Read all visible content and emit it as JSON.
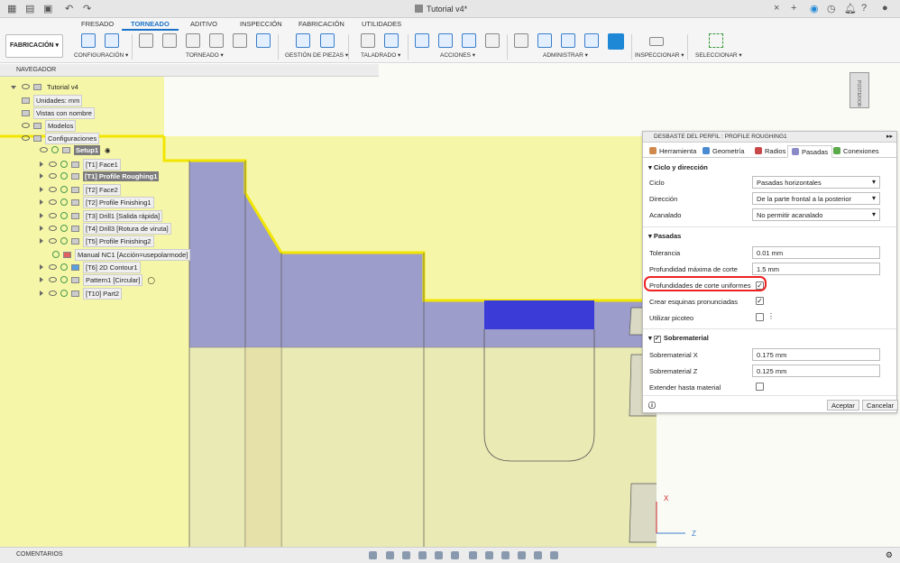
{
  "titlebar": {
    "doc_title": "Tutorial v4*"
  },
  "ribbon": {
    "tabs": [
      "FRESADO",
      "TORNEADO",
      "ADITIVO",
      "INSPECCIÓN",
      "FABRICACIÓN",
      "UTILIDADES"
    ],
    "active_tab": "TORNEADO",
    "workspace_button": "FABRICACIÓN ▾",
    "groups": [
      "CONFIGURACIÓN ▾",
      "TORNEADO ▾",
      "GESTIÓN DE PIEZAS ▾",
      "TALADRADO ▾",
      "ACCIONES ▾",
      "ADMINISTRAR ▾",
      "INSPECCIONAR ▾",
      "SELECCIONAR ▾"
    ]
  },
  "browser": {
    "title": "NAVEGADOR",
    "items": [
      {
        "label": "Tutorial v4"
      },
      {
        "label": "Unidades: mm"
      },
      {
        "label": "Vistas con nombre"
      },
      {
        "label": "Modelos"
      },
      {
        "label": "Configuraciones"
      },
      {
        "label": "Setup1"
      },
      {
        "label": "[T1] Face1"
      },
      {
        "label": "[T1] Profile Roughing1"
      },
      {
        "label": "[T2] Face2"
      },
      {
        "label": "[T2] Profile Finishing1"
      },
      {
        "label": "[T3] Drill1 [Salida rápida]"
      },
      {
        "label": "[T4] Drill3 [Rotura de viruta]"
      },
      {
        "label": "[T5] Profile Finishing2"
      },
      {
        "label": "Manual NC1 [Acción=usepolarmode]"
      },
      {
        "label": "[T6] 2D Contour1"
      },
      {
        "label": "Pattern1 [Circular]"
      },
      {
        "label": "[T10] Part2"
      }
    ]
  },
  "panel": {
    "title": "DESBASTE DEL PERFIL : PROFILE ROUGHING1",
    "tabs": [
      "Herramienta",
      "Geometría",
      "Radios",
      "Pasadas",
      "Conexiones"
    ],
    "active_tab": "Pasadas",
    "sections": {
      "ciclo": {
        "header": "Ciclo y dirección",
        "ciclo_label": "Ciclo",
        "ciclo_value": "Pasadas horizontales",
        "direccion_label": "Dirección",
        "direccion_value": "De la parte frontal a la posterior",
        "acanalado_label": "Acanalado",
        "acanalado_value": "No permitir acanalado"
      },
      "pasadas": {
        "header": "Pasadas",
        "tolerancia_label": "Tolerancia",
        "tolerancia_value": "0.01 mm",
        "prof_label": "Profundidad máxima de corte",
        "prof_value": "1.5 mm",
        "uniformes_label": "Profundidades de corte uniformes",
        "uniformes_checked": true,
        "esquinas_label": "Crear esquinas pronunciadas",
        "esquinas_checked": true,
        "picoteo_label": "Utilizar picoteo",
        "picoteo_checked": false
      },
      "sobrematerial": {
        "header": "Sobrematerial",
        "x_label": "Sobrematerial X",
        "x_value": "0.175 mm",
        "z_label": "Sobrematerial Z",
        "z_value": "0.125 mm",
        "extender_label": "Extender hasta material",
        "extender_checked": false
      }
    },
    "buttons": {
      "ok": "Aceptar",
      "cancel": "Cancelar"
    }
  },
  "statusbar": {
    "comments": "COMENTARIOS"
  },
  "viewcube": {
    "face": "POSTERIOR",
    "axis_z": "Z",
    "axis_x": "X"
  },
  "colors": {
    "accent": "#1a73c8",
    "stock": "#f4f4a6",
    "part": "#9a9ac8",
    "highlight": "#e22222",
    "outline": "#f2e600"
  }
}
